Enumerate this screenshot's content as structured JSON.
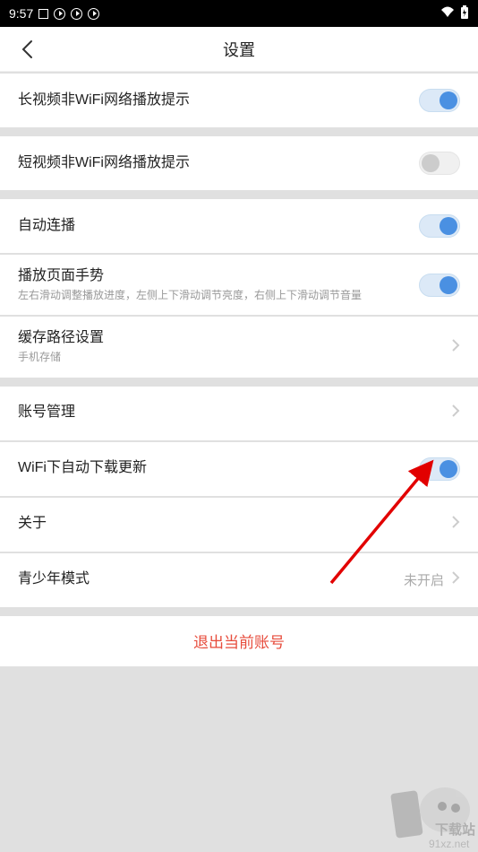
{
  "status_bar": {
    "time": "9:57"
  },
  "header": {
    "title": "设置"
  },
  "rows": {
    "long_video_wifi": {
      "title": "长视频非WiFi网络播放提示",
      "state": "on"
    },
    "short_video_wifi": {
      "title": "短视频非WiFi网络播放提示",
      "state": "off"
    },
    "auto_play": {
      "title": "自动连播",
      "state": "on"
    },
    "gesture": {
      "title": "播放页面手势",
      "subtitle": "左右滑动调整播放进度，左侧上下滑动调节亮度，右侧上下滑动调节音量",
      "state": "on"
    },
    "cache_path": {
      "title": "缓存路径设置",
      "subtitle": "手机存储"
    },
    "account_manage": {
      "title": "账号管理"
    },
    "wifi_auto_download": {
      "title": "WiFi下自动下载更新",
      "state": "on"
    },
    "about": {
      "title": "关于"
    },
    "teen_mode": {
      "title": "青少年模式",
      "value": "未开启"
    }
  },
  "logout": {
    "label": "退出当前账号"
  },
  "watermark": {
    "line1": "下载站",
    "line2": "91xz.net"
  }
}
